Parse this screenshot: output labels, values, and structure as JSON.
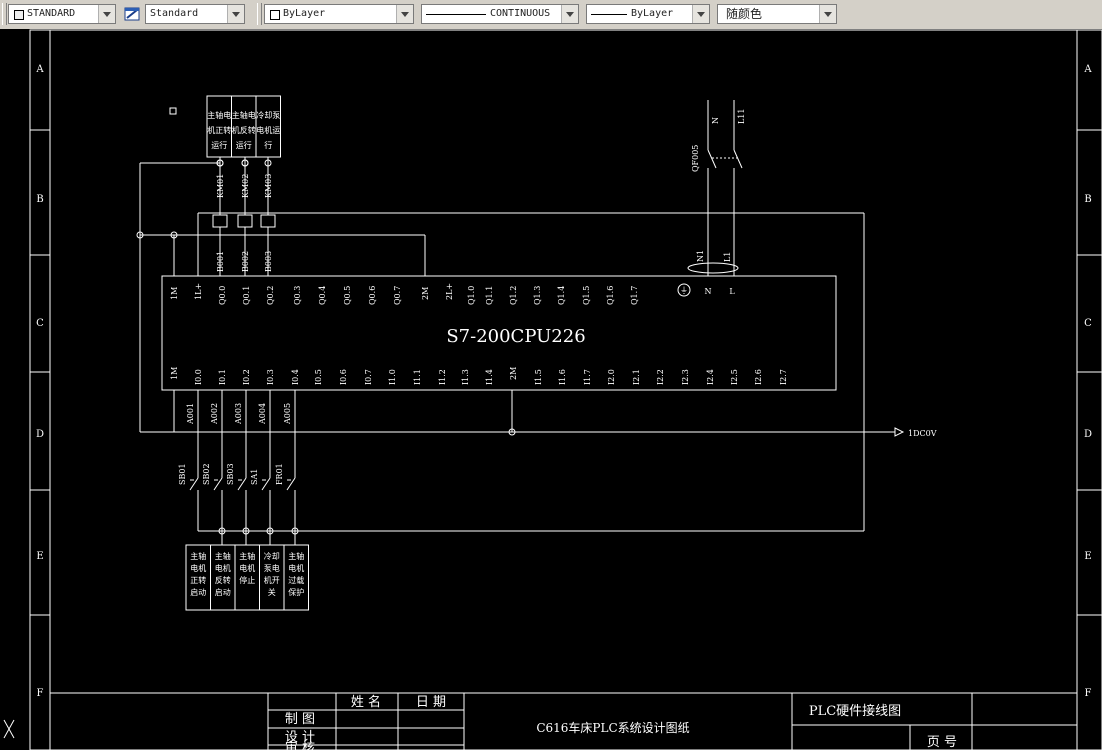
{
  "toolbar": {
    "text_style": "STANDARD",
    "dim_style": "Standard",
    "layer": "ByLayer",
    "linetype": "CONTINUOUS",
    "lineweight": "ByLayer",
    "color": "随颜色"
  },
  "grid": {
    "rows": [
      "A",
      "B",
      "C",
      "D",
      "E",
      "F"
    ]
  },
  "plc": {
    "model": "S7-200CPU226",
    "top_terminals": [
      "1M",
      "1L+",
      "Q0.0",
      "Q0.1",
      "Q0.2",
      "Q0.3",
      "Q0.4",
      "Q0.5",
      "Q0.6",
      "Q0.7",
      "2M",
      "2L+",
      "Q1.0",
      "Q1.1",
      "Q1.2",
      "Q1.3",
      "Q1.4",
      "Q1.5",
      "Q1.6",
      "Q1.7",
      "⏚",
      "N",
      "L"
    ],
    "bottom_terminals": [
      "1M",
      "I0.0",
      "I0.1",
      "I0.2",
      "I0.3",
      "I0.4",
      "I0.5",
      "I0.6",
      "I0.7",
      "I1.0",
      "I1.1",
      "I1.2",
      "I1.3",
      "I1.4",
      "2M",
      "I1.5",
      "I1.6",
      "I1.7",
      "I2.0",
      "I2.1",
      "I2.2",
      "I2.3",
      "I2.4",
      "I2.5",
      "I2.6",
      "I2.7"
    ]
  },
  "outputs": {
    "boxes": [
      "主轴电机正转运行",
      "主轴电机反转运行",
      "冷却泵电机运行"
    ],
    "coils": [
      "KM01",
      "KM02",
      "KM03"
    ],
    "wires": [
      "B001",
      "B002",
      "B003"
    ]
  },
  "inputs": {
    "wires": [
      "A001",
      "A002",
      "A003",
      "A004",
      "A005"
    ],
    "switches": [
      "SB01",
      "SB02",
      "SB03",
      "SA1",
      "FR01"
    ],
    "boxes": [
      "主轴电机正转启动",
      "主轴电机反转启动",
      "主轴电机停止",
      "冷却泵电机开关",
      "主轴电机过载保护"
    ]
  },
  "power": {
    "breaker": "QF005",
    "n": "N",
    "l": "L11",
    "n2": "N1",
    "l2": "L1",
    "dc": "1DC0V"
  },
  "title_block": {
    "name_header": "姓 名",
    "date_header": "日 期",
    "row_draw": "制 图",
    "row_design": "设 计",
    "row_review": "审 核",
    "project": "C616车床PLC系统设计图纸",
    "drawing_name": "PLC硬件接线图",
    "page": "页 号"
  }
}
